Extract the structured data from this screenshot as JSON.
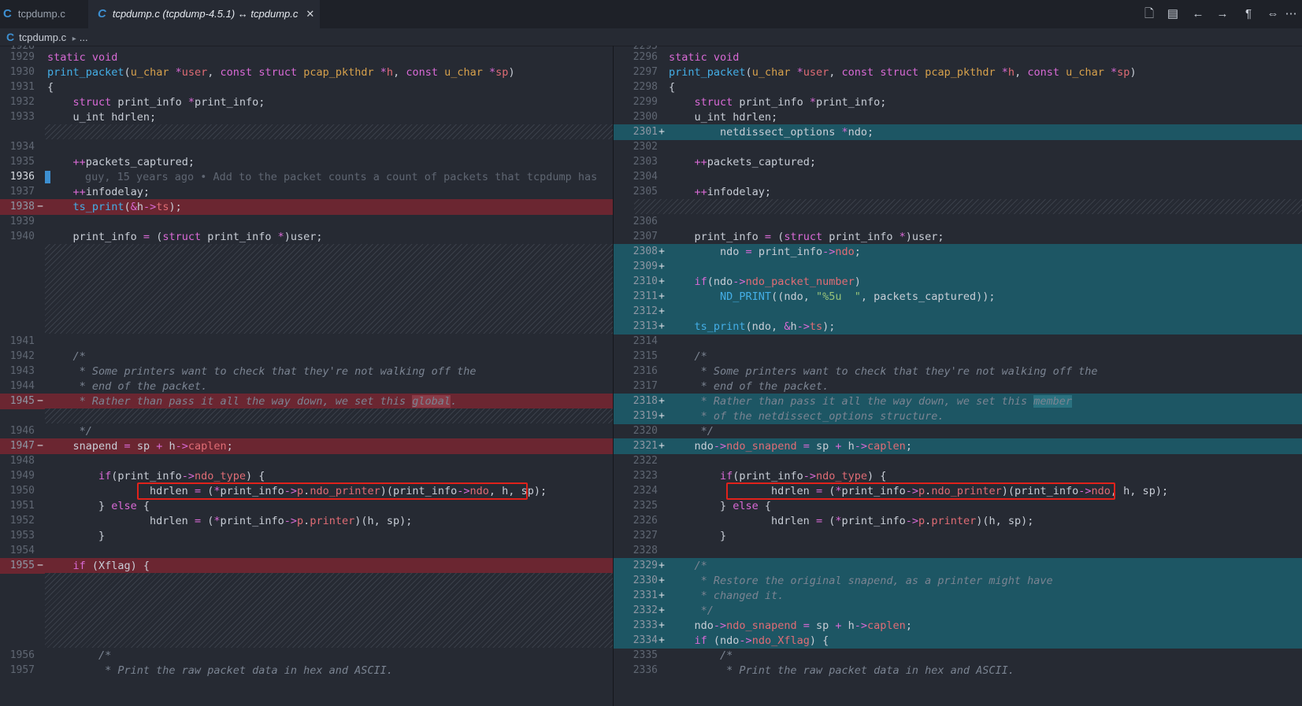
{
  "tabs": [
    {
      "label": "tcpdump.c",
      "active": false
    },
    {
      "label": "tcpdump.c (tcpdump-4.5.1) ↔ tcpdump.c",
      "active": true,
      "close": "✕"
    }
  ],
  "toolbar": {
    "icons": [
      "open-file-icon",
      "open-changes-icon",
      "previous-change-icon",
      "next-change-icon",
      "whitespace-icon",
      "inline-view-icon",
      "more-icon"
    ]
  },
  "breadcrumb": {
    "file": "tcpdump.c",
    "sep": "▸",
    "rest": "..."
  },
  "blame": "guy, 15 years ago • Add to the packet counts a count of packets that tcpdump has",
  "left": {
    "top_partial": "1928",
    "lines": [
      {
        "n": "1929",
        "html": "<span class='k'>static</span> <span class='k'>void</span>"
      },
      {
        "n": "1930",
        "html": "<span class='f'>print_packet</span>(<span class='t'>u_char</span> <span class='o'>*</span><span class='p'>user</span>, <span class='k'>const</span> <span class='k'>struct</span> <span class='t'>pcap_pkthdr</span> <span class='o'>*</span><span class='p'>h</span>, <span class='k'>const</span> <span class='t'>u_char</span> <span class='o'>*</span><span class='p'>sp</span>)"
      },
      {
        "n": "1931",
        "html": "{"
      },
      {
        "n": "1932",
        "html": "    <span class='k'>struct</span> print_info <span class='o'>*</span>print_info;"
      },
      {
        "n": "1933",
        "html": "    u_int hdrlen;"
      },
      {
        "hatch": 1
      },
      {
        "n": "1934",
        "html": ""
      },
      {
        "n": "1935",
        "html": "    <span class='o'>++</span>packets_captured;"
      },
      {
        "n": "1936",
        "cur": true,
        "blame": true,
        "html": ""
      },
      {
        "n": "1937",
        "html": "    <span class='o'>++</span>infodelay;"
      },
      {
        "n": "1938",
        "del": true,
        "html": "    <span class='f'>ts_print</span>(<span class='o'>&amp;</span>h<span class='o'>-&gt;</span><span class='p'>ts</span>);"
      },
      {
        "n": "1939",
        "html": ""
      },
      {
        "n": "1940",
        "html": "    print_info <span class='o'>=</span> (<span class='k'>struct</span> print_info <span class='o'>*</span>)user;"
      },
      {
        "hatch": 6
      },
      {
        "n": "1941",
        "html": ""
      },
      {
        "n": "1942",
        "html": "    <span class='c'>/*</span>"
      },
      {
        "n": "1943",
        "html": "<span class='c'>     * Some printers want to check that they're not walking off the</span>"
      },
      {
        "n": "1944",
        "html": "<span class='c'>     * end of the packet.</span>"
      },
      {
        "n": "1945",
        "del": true,
        "html": "<span class='c'>     * Rather than pass it all the way down, we set this <span class='hlword'>global</span>.</span>"
      },
      {
        "hatch": 1
      },
      {
        "n": "1946",
        "html": "<span class='c'>     */</span>"
      },
      {
        "n": "1947",
        "del": true,
        "html": "    snapend <span class='o'>=</span> sp <span class='o'>+</span> h<span class='o'>-&gt;</span><span class='p'>caplen</span>;"
      },
      {
        "n": "1948",
        "html": ""
      },
      {
        "n": "1949",
        "html": "        <span class='k'>if</span>(print_info<span class='o'>-&gt;</span><span class='p'>ndo_type</span>) {"
      },
      {
        "n": "1950",
        "box": true,
        "html": "                hdrlen <span class='o'>=</span> (<span class='o'>*</span>print_info<span class='o'>-&gt;</span><span class='p'>p</span>.<span class='p'>ndo_printer</span>)(print_info<span class='o'>-&gt;</span><span class='p'>ndo</span>, h, sp);"
      },
      {
        "n": "1951",
        "html": "        } <span class='k'>else</span> {"
      },
      {
        "n": "1952",
        "html": "                hdrlen <span class='o'>=</span> (<span class='o'>*</span>print_info<span class='o'>-&gt;</span><span class='p'>p</span>.<span class='p'>printer</span>)(h, sp);"
      },
      {
        "n": "1953",
        "html": "        }"
      },
      {
        "n": "1954",
        "html": ""
      },
      {
        "n": "1955",
        "del": true,
        "html": "    <span class='k'>if</span> (Xflag) {"
      },
      {
        "hatch": 5
      },
      {
        "n": "1956",
        "html": "        <span class='c'>/*</span>"
      },
      {
        "n": "1957",
        "html": "<span class='c'>         * Print the raw packet data in hex and ASCII.</span>"
      }
    ]
  },
  "right": {
    "top_partial": "2295",
    "lines": [
      {
        "n": "2296",
        "html": "<span class='k'>static</span> <span class='k'>void</span>"
      },
      {
        "n": "2297",
        "html": "<span class='f'>print_packet</span>(<span class='t'>u_char</span> <span class='o'>*</span><span class='p'>user</span>, <span class='k'>const</span> <span class='k'>struct</span> <span class='t'>pcap_pkthdr</span> <span class='o'>*</span><span class='p'>h</span>, <span class='k'>const</span> <span class='t'>u_char</span> <span class='o'>*</span><span class='p'>sp</span>)"
      },
      {
        "n": "2298",
        "html": "{"
      },
      {
        "n": "2299",
        "html": "    <span class='k'>struct</span> print_info <span class='o'>*</span>print_info;"
      },
      {
        "n": "2300",
        "html": "    u_int hdrlen;"
      },
      {
        "n": "2301",
        "add": true,
        "html": "        netdissect_options <span class='o'>*</span>ndo;"
      },
      {
        "n": "2302",
        "html": ""
      },
      {
        "n": "2303",
        "html": "    <span class='o'>++</span>packets_captured;"
      },
      {
        "n": "2304",
        "html": ""
      },
      {
        "n": "2305",
        "html": "    <span class='o'>++</span>infodelay;"
      },
      {
        "hatch": 1
      },
      {
        "n": "2306",
        "html": ""
      },
      {
        "n": "2307",
        "html": "    print_info <span class='o'>=</span> (<span class='k'>struct</span> print_info <span class='o'>*</span>)user;"
      },
      {
        "n": "2308",
        "add": true,
        "html": "        ndo <span class='o'>=</span> print_info<span class='o'>-&gt;</span><span class='p'>ndo</span>;"
      },
      {
        "n": "2309",
        "add": true,
        "html": ""
      },
      {
        "n": "2310",
        "add": true,
        "html": "    <span class='k'>if</span>(ndo<span class='o'>-&gt;</span><span class='p'>ndo_packet_number</span>)"
      },
      {
        "n": "2311",
        "add": true,
        "html": "        <span class='f'>ND_PRINT</span>((ndo, <span class='s'>\"%5u  \"</span>, packets_captured));"
      },
      {
        "n": "2312",
        "add": true,
        "html": ""
      },
      {
        "n": "2313",
        "add": true,
        "html": "    <span class='f'>ts_print</span>(ndo, <span class='o'>&amp;</span>h<span class='o'>-&gt;</span><span class='p'>ts</span>);"
      },
      {
        "n": "2314",
        "html": ""
      },
      {
        "n": "2315",
        "html": "    <span class='c'>/*</span>"
      },
      {
        "n": "2316",
        "html": "<span class='c'>     * Some printers want to check that they're not walking off the</span>"
      },
      {
        "n": "2317",
        "html": "<span class='c'>     * end of the packet.</span>"
      },
      {
        "n": "2318",
        "add": true,
        "html": "<span class='c'>     * Rather than pass it all the way down, we set this <span class='hlword-add'>member</span></span>"
      },
      {
        "n": "2319",
        "add": true,
        "html": "<span class='c'>     * of the netdissect_options structure.</span>"
      },
      {
        "n": "2320",
        "html": "<span class='c'>     */</span>"
      },
      {
        "n": "2321",
        "add": true,
        "html": "    ndo<span class='o'>-&gt;</span><span class='p'>ndo_snapend</span> <span class='o'>=</span> sp <span class='o'>+</span> h<span class='o'>-&gt;</span><span class='p'>caplen</span>;"
      },
      {
        "n": "2322",
        "html": ""
      },
      {
        "n": "2323",
        "html": "        <span class='k'>if</span>(print_info<span class='o'>-&gt;</span><span class='p'>ndo_type</span>) {"
      },
      {
        "n": "2324",
        "box": true,
        "html": "                hdrlen <span class='o'>=</span> (<span class='o'>*</span>print_info<span class='o'>-&gt;</span><span class='p'>p</span>.<span class='p'>ndo_printer</span>)(print_info<span class='o'>-&gt;</span><span class='p'>ndo</span>, h, sp);"
      },
      {
        "n": "2325",
        "html": "        } <span class='k'>else</span> {"
      },
      {
        "n": "2326",
        "html": "                hdrlen <span class='o'>=</span> (<span class='o'>*</span>print_info<span class='o'>-&gt;</span><span class='p'>p</span>.<span class='p'>printer</span>)(h, sp);"
      },
      {
        "n": "2327",
        "html": "        }"
      },
      {
        "n": "2328",
        "html": ""
      },
      {
        "n": "2329",
        "add": true,
        "html": "    <span class='c'>/*</span>"
      },
      {
        "n": "2330",
        "add": true,
        "html": "<span class='c'>     * Restore the original snapend, as a printer might have</span>"
      },
      {
        "n": "2331",
        "add": true,
        "html": "<span class='c'>     * changed it.</span>"
      },
      {
        "n": "2332",
        "add": true,
        "html": "<span class='c'>     */</span>"
      },
      {
        "n": "2333",
        "add": true,
        "html": "    ndo<span class='o'>-&gt;</span><span class='p'>ndo_snapend</span> <span class='o'>=</span> sp <span class='o'>+</span> h<span class='o'>-&gt;</span><span class='p'>caplen</span>;"
      },
      {
        "n": "2334",
        "add": true,
        "html": "    <span class='k'>if</span> (ndo<span class='o'>-&gt;</span><span class='p'>ndo_Xflag</span>) {"
      },
      {
        "n": "2335",
        "html": "        <span class='c'>/*</span>"
      },
      {
        "n": "2336",
        "html": "<span class='c'>         * Print the raw packet data in hex and ASCII.</span>"
      }
    ]
  }
}
